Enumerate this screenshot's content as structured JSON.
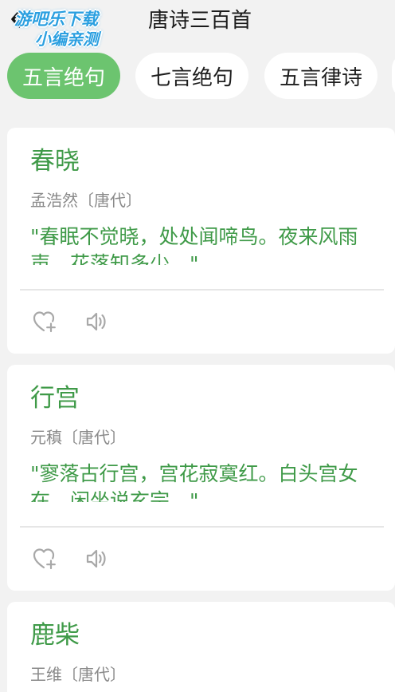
{
  "header": {
    "title": "唐诗三百首",
    "back_icon": "back-arrow-icon",
    "watermark_line1": "游吧乐下载",
    "watermark_line2": "小编亲测"
  },
  "tabs": [
    {
      "label": "五言绝句",
      "active": true
    },
    {
      "label": "七言绝句",
      "active": false
    },
    {
      "label": "五言律诗",
      "active": false
    },
    {
      "label": "",
      "active": false
    }
  ],
  "poems": [
    {
      "title": "春晓",
      "author": "孟浩然〔唐代〕",
      "excerpt": "\"春眠不觉晓，处处闻啼鸟。夜来风雨声，花落知多少。\"",
      "like_icon": "heart-plus-icon",
      "sound_icon": "speaker-icon"
    },
    {
      "title": "行宫",
      "author": "元稹〔唐代〕",
      "excerpt": "\"寥落古行宫，宫花寂寞红。白头宫女在，闲坐说玄宗。\"",
      "like_icon": "heart-plus-icon",
      "sound_icon": "speaker-icon"
    },
    {
      "title": "鹿柴",
      "author": "王维〔唐代〕"
    }
  ],
  "colors": {
    "accent_green": "#6cc46f",
    "poem_green": "#3f9a48",
    "background": "#f2f2f2",
    "muted_text": "#8a8a8a"
  }
}
